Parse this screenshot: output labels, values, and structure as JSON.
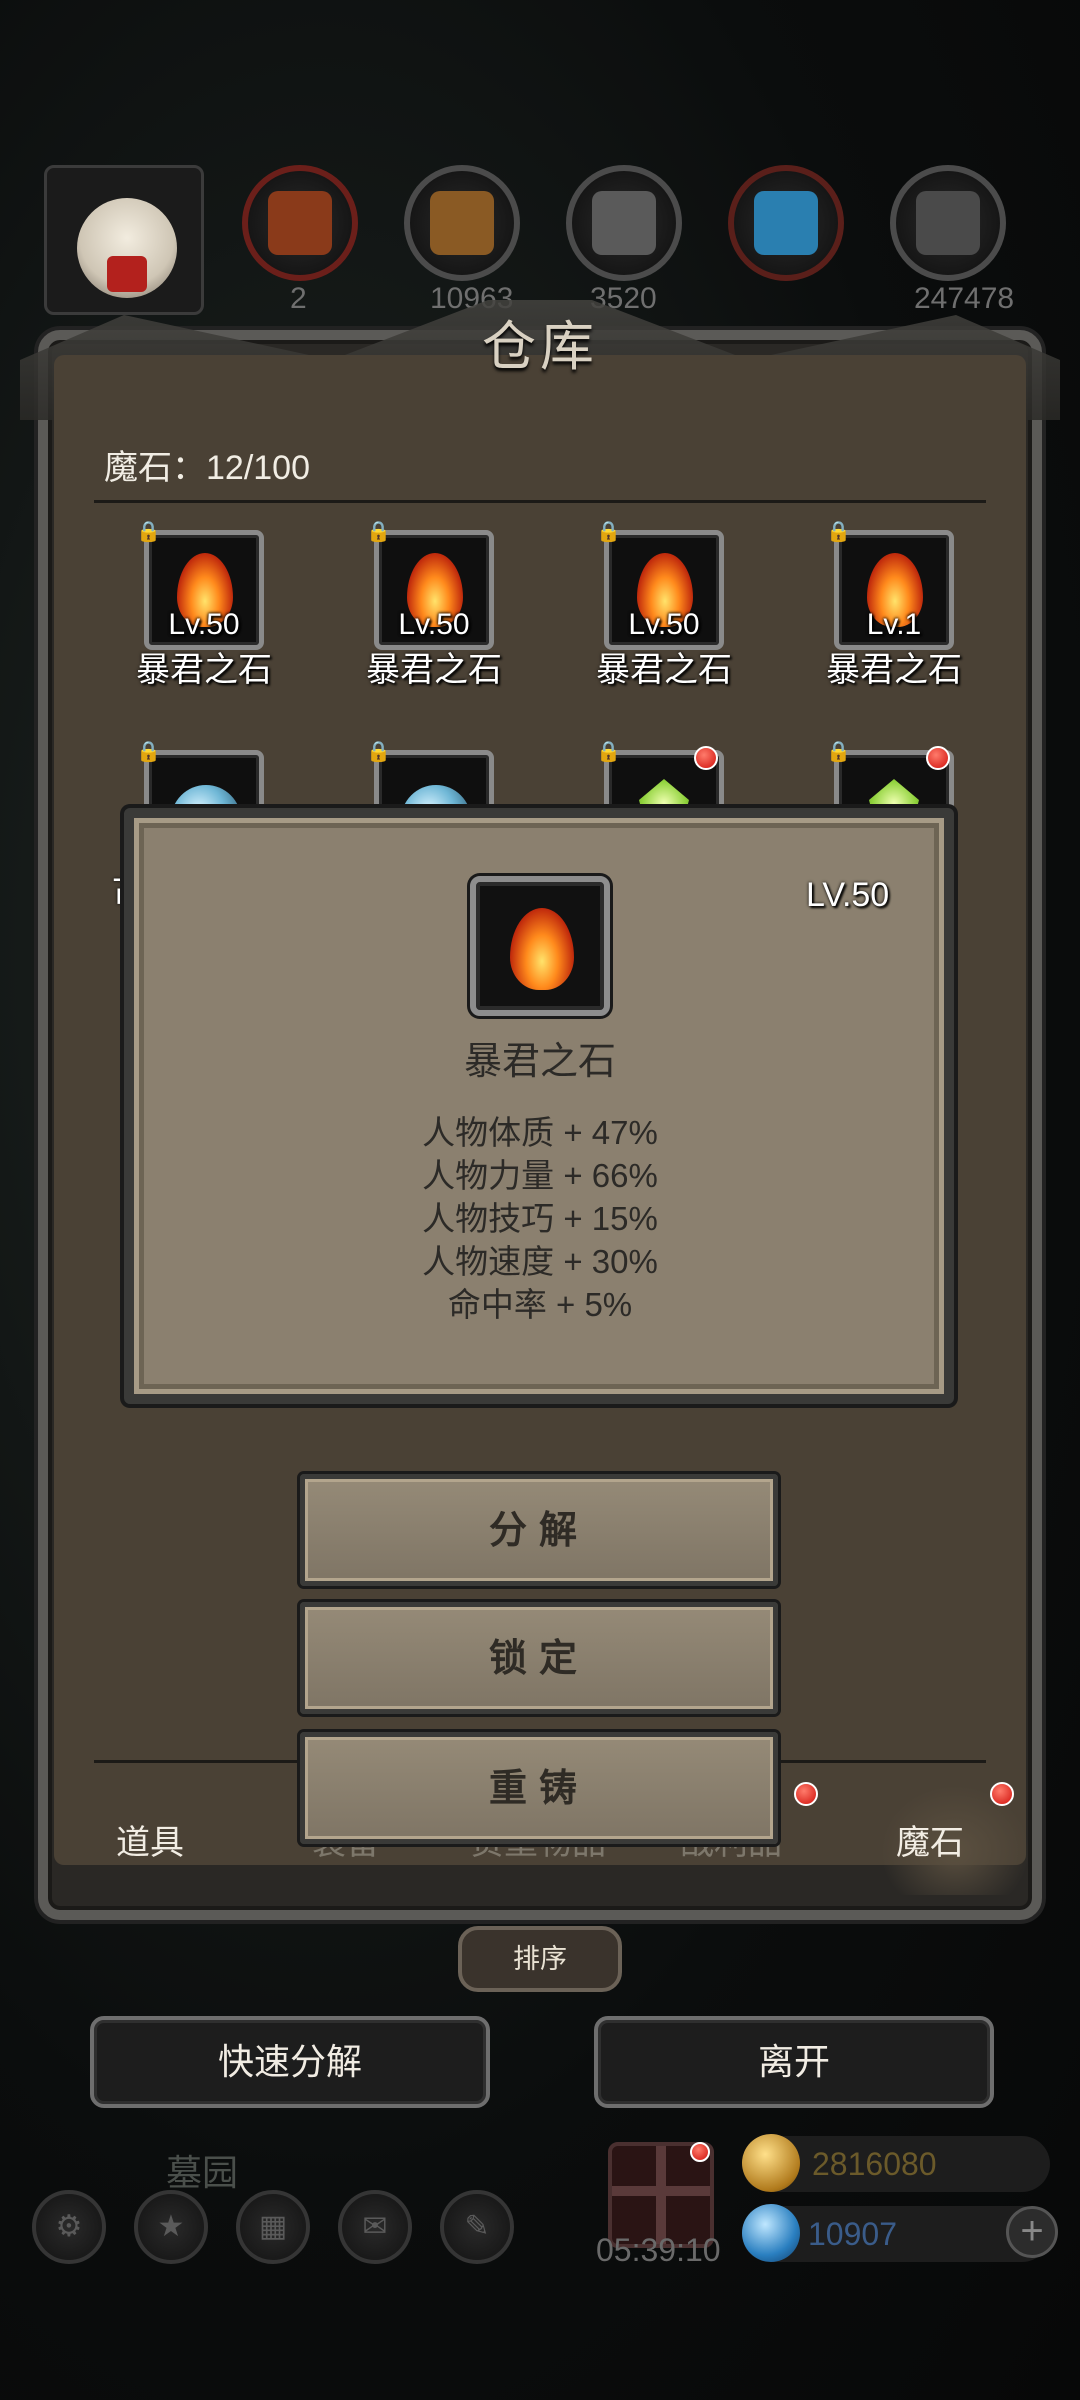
{
  "header": {
    "resource_counts": [
      "2",
      "10963",
      "3520",
      "",
      "247478"
    ]
  },
  "warehouse": {
    "title": "仓库",
    "magic_stone_capacity": "魔石：12/100",
    "items_row1": [
      {
        "level": "Lv.50",
        "name": "暴君之石"
      },
      {
        "level": "Lv.50",
        "name": "暴君之石"
      },
      {
        "level": "Lv.50",
        "name": "暴君之石"
      },
      {
        "level": "Lv.1",
        "name": "暴君之石"
      }
    ],
    "row2_partial_label": "古"
  },
  "detail_popup": {
    "level": "LV.50",
    "name": "暴君之石",
    "stats": [
      "人物体质 + 47%",
      "人物力量 + 66%",
      "人物技巧 + 15%",
      "人物速度 + 30%",
      "命中率 + 5%"
    ],
    "actions": [
      "分解",
      "锁定",
      "重铸"
    ]
  },
  "tabs": [
    {
      "label": "道具",
      "active": false
    },
    {
      "label": "装备",
      "active": false
    },
    {
      "label": "贵重物品",
      "active": false
    },
    {
      "label": "战利品",
      "active": false
    },
    {
      "label": "魔石",
      "active": true
    }
  ],
  "controls": {
    "sort": "排序",
    "quick_decompose": "快速分解",
    "leave": "离开"
  },
  "bottom": {
    "location": "墓园",
    "timer": "05:39:10",
    "gold": "2816080",
    "gems": "10907"
  },
  "colors": {
    "accent_red_dot": "#d0110c",
    "parchment": "#8b806f",
    "gold_text": "#6b5a2a",
    "gem_text": "#3a5c8a"
  }
}
